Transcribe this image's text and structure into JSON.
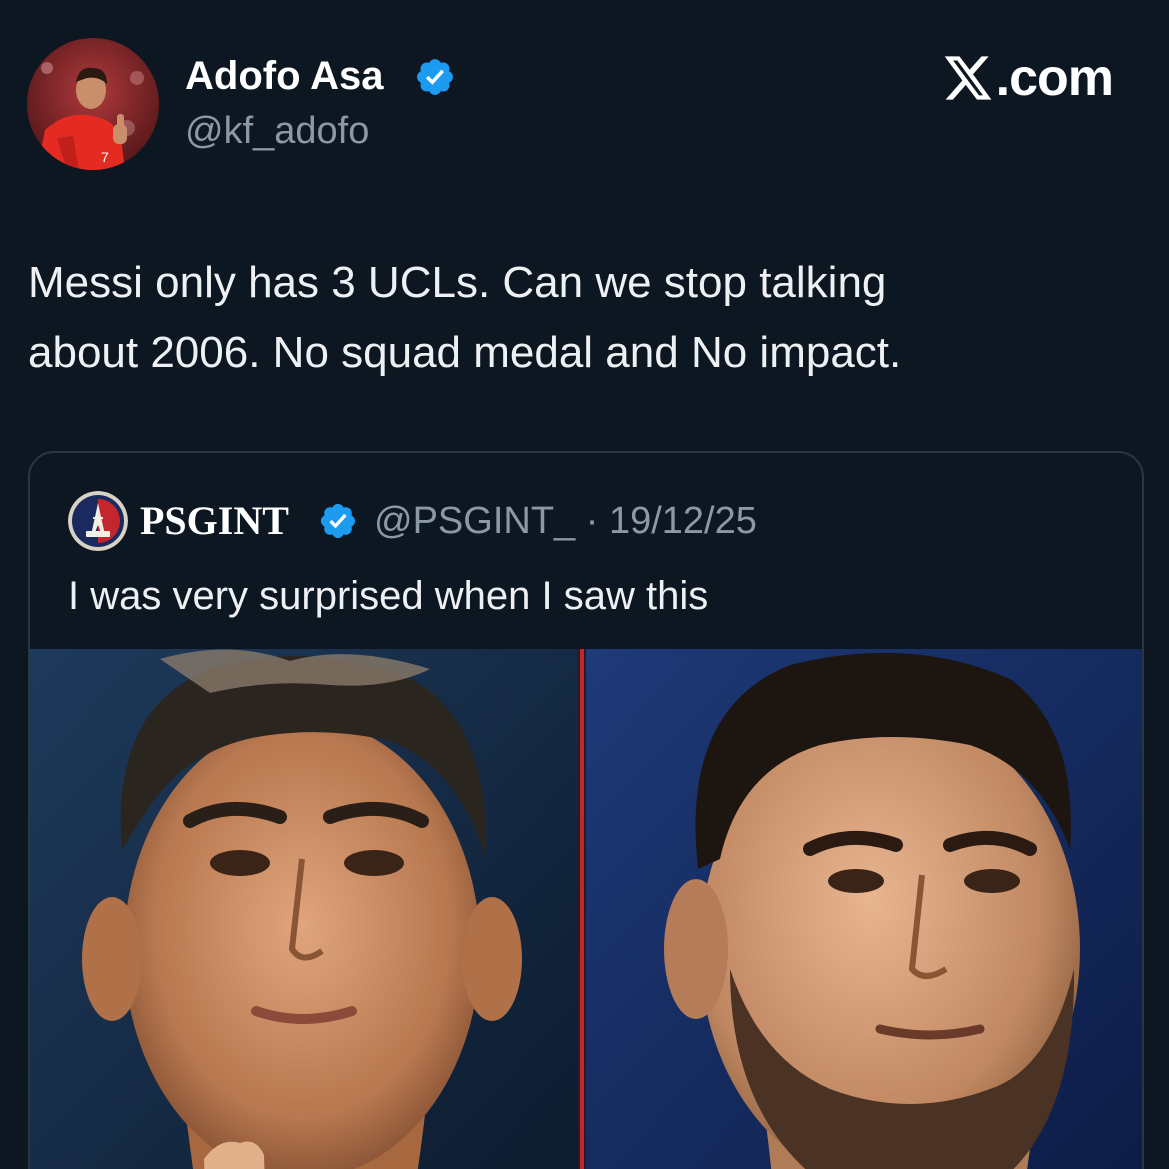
{
  "post": {
    "author_name": "Adofo Asa",
    "author_handle": "@kf_adofo",
    "text_lines": [
      "Messi only has 3 UCLs. Can we stop talking",
      "about 2006. No squad medal and No impact."
    ]
  },
  "brand": {
    "text": ".com",
    "icon": "x-logo-icon"
  },
  "quote": {
    "author_name": "PSGINT",
    "meta": "@PSGINT_ · 19/12/25",
    "text": "I was very surprised when I saw this",
    "media_description_icon": "photo-comparison"
  },
  "colors": {
    "background": "#0d1722",
    "verified_blue": "#1d9bf0",
    "secondary_text": "#8b98a5",
    "card_border": "#2c3640",
    "divider_red": "#c0282d"
  }
}
